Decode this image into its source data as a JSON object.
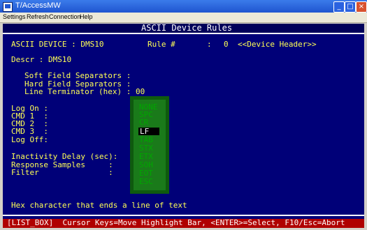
{
  "window": {
    "title": "T/AccessMW",
    "controls": {
      "minimize": "_",
      "maximize": "□",
      "close": "×"
    }
  },
  "menu": [
    {
      "label": "Settings"
    },
    {
      "label": "Refresh"
    },
    {
      "label": "Connection"
    },
    {
      "label": "Help"
    }
  ],
  "screen": {
    "title": "ASCII Device Rules",
    "device_label": "ASCII DEVICE : DMS10",
    "rule_label": "Rule #",
    "rule_sep": ":",
    "rule_value": "0",
    "rule_header": "<<Device Header>>",
    "descr": "Descr : DMS10",
    "soft_sep": "Soft Field Separators :",
    "hard_sep": "Hard Field Separators :",
    "line_term": "Line Terminator (hex) : 00",
    "log_on": "Log On :",
    "cmd1": "CMD 1  :",
    "cmd2": "CMD 2  :",
    "cmd3": "CMD 3  :",
    "log_off": "Log Off:",
    "inactivity": "Inactivity Delay (sec):",
    "samples": "Response Samples     :",
    "filter": "Filter               :",
    "help_text": "Hex character that ends a line of text",
    "status_bar": "[LIST_BOX]  Cursor Keys=Move Highlight Bar, <ENTER>=Select, F10/Esc=Abort"
  },
  "listbox": {
    "items": [
      "NONE",
      "SPC",
      "CR",
      "LF",
      "TAB",
      "STX",
      "ETX",
      "SOH",
      "EOT",
      "ESC"
    ],
    "selected": "LF"
  },
  "colors": {
    "terminal_bg": "#000078",
    "terminal_fg": "#ffff55",
    "listbox_bg": "#1a7a1a",
    "listbox_fg": "#00a600",
    "status_bg": "#b00000"
  }
}
